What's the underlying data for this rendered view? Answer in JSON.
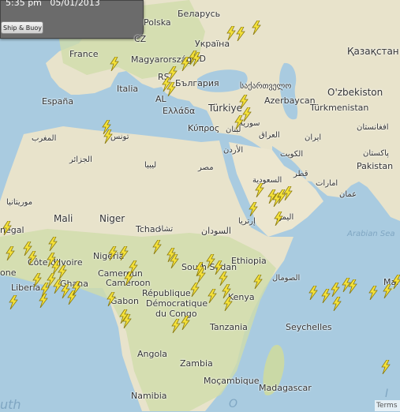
{
  "hud": {
    "time": "5:35 pm",
    "date": "05/01/2013",
    "toggle_label": "Ship & Buoy"
  },
  "terms": "Terms",
  "colors": {
    "water": "#a9cbe0",
    "land": "#e6e2cc",
    "green": "#cad9a6",
    "desert": "#ece6cf",
    "bolt": "#f5e23a"
  },
  "labels": {
    "polska": "Polska",
    "belarus": "Беларусь",
    "cz": "CZ",
    "ukraina": "Україна",
    "france": "France",
    "magyar": "Magyarország",
    "md": "MD",
    "kazakhstan": "Қазақстан",
    "rs": "RS",
    "bulgaria": "България",
    "georgia": "საქართველო",
    "uzbekiston": "O'zbekiston",
    "espana": "España",
    "italia": "Italia",
    "al": "AL",
    "ellada": "Ελλάδα",
    "turkiye": "Türkiye",
    "azerbaycan": "Azerbaycan",
    "turkmenistan": "Türkmenistan",
    "kypros": "Κύπρος",
    "syria": "سورية",
    "lebanon": "لبنان",
    "iraq": "العراق",
    "iran": "ایران",
    "afghanistan": "افغانستان",
    "tunisia": "تونس",
    "morocco": "المغرب",
    "jordan": "الأردن",
    "kuwait": "الكويت",
    "pakistan": "Pakistan",
    "pakistan_ur": "پاکستان",
    "algeria": "الجزائر",
    "libya": "ليبيا",
    "egypt": "مصر",
    "saudi": "السعودية",
    "qatar": "قطر",
    "uae": "امارات",
    "oman": "عمان",
    "mauritania": "موريتانيا",
    "mali": "Mali",
    "niger": "Niger",
    "tchad": "Tchad",
    "tchad_ar": "تشاد",
    "sudan": "السودان",
    "eritrea": "إرتريا",
    "yemen": "اليمن",
    "arabian_sea": "Arabian Sea",
    "senegal": "négal",
    "nigeria": "Nigeria",
    "south_sudan": "South Sudan",
    "ethiopia": "Ethiopia",
    "somalia": "الصومال",
    "cote": "Côte d'Ivoire",
    "ghana": "Ghana",
    "liberia": "Liberia",
    "one": "one",
    "cameroun": "Cameroun",
    "cameroon": "Cameroon",
    "rep": "République",
    "dem": "Démocratique",
    "congo": "du Congo",
    "gabon": "Gabon",
    "kenya": "Kenya",
    "tanzania": "Tanzania",
    "seychelles": "Seychelles",
    "angola": "Angola",
    "zambia": "Zambia",
    "mozambique": "Moçambique",
    "namibia": "Namibia",
    "madagascar": "Madagascar",
    "south_frag": "uth",
    "o_frag": "O",
    "i_frag": "I",
    "maldives_frag": "Mal"
  },
  "lightning_strikes_count": 70
}
